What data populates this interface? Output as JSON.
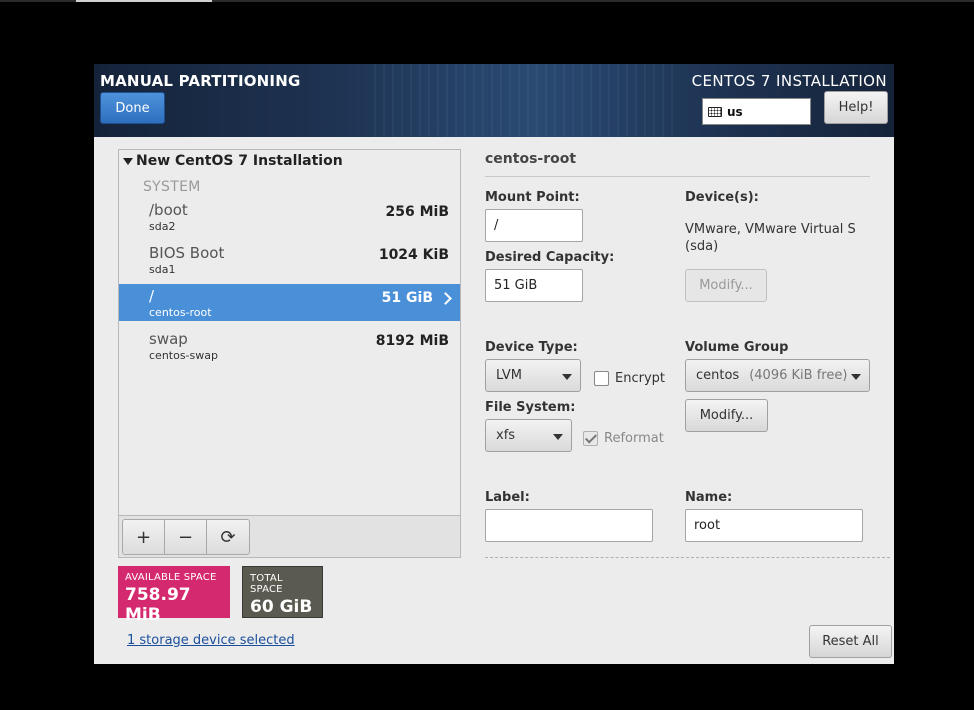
{
  "header": {
    "title": "MANUAL PARTITIONING",
    "product": "CENTOS 7 INSTALLATION",
    "done_label": "Done",
    "keyboard_layout": "us",
    "help_label": "Help!"
  },
  "tree": {
    "root_label": "New CentOS 7 Installation",
    "group_label": "SYSTEM",
    "partitions": [
      {
        "name": "/boot",
        "device": "sda2",
        "size": "256 MiB"
      },
      {
        "name": "BIOS Boot",
        "device": "sda1",
        "size": "1024 KiB"
      },
      {
        "name": "/",
        "device": "centos-root",
        "size": "51 GiB",
        "selected": true
      },
      {
        "name": "swap",
        "device": "centos-swap",
        "size": "8192 MiB"
      }
    ],
    "toolbar": {
      "add": "+",
      "remove": "−",
      "refresh": "⟳"
    }
  },
  "space": {
    "available_label": "AVAILABLE SPACE",
    "available_value": "758.97 MiB",
    "total_label": "TOTAL SPACE",
    "total_value": "60 GiB",
    "available_color": "#d5296f"
  },
  "storage_link": "1 storage device selected",
  "reset_label": "Reset All",
  "detail": {
    "title": "centos-root",
    "mount_point_label": "Mount Point:",
    "mount_point_value": "/",
    "capacity_label": "Desired Capacity:",
    "capacity_value": "51 GiB",
    "devices_label": "Device(s):",
    "devices_value_line1": "VMware, VMware Virtual S",
    "devices_value_line2": "(sda)",
    "modify_label": "Modify...",
    "device_type_label": "Device Type:",
    "device_type_value": "LVM",
    "encrypt_label": "Encrypt",
    "file_system_label": "File System:",
    "file_system_value": "xfs",
    "reformat_label": "Reformat",
    "volume_group_label": "Volume Group",
    "volume_group_value": "centos",
    "volume_group_free": "(4096 KiB free)",
    "vg_modify_label": "Modify...",
    "label_label": "Label:",
    "label_value": "",
    "name_label": "Name:",
    "name_value": "root"
  }
}
